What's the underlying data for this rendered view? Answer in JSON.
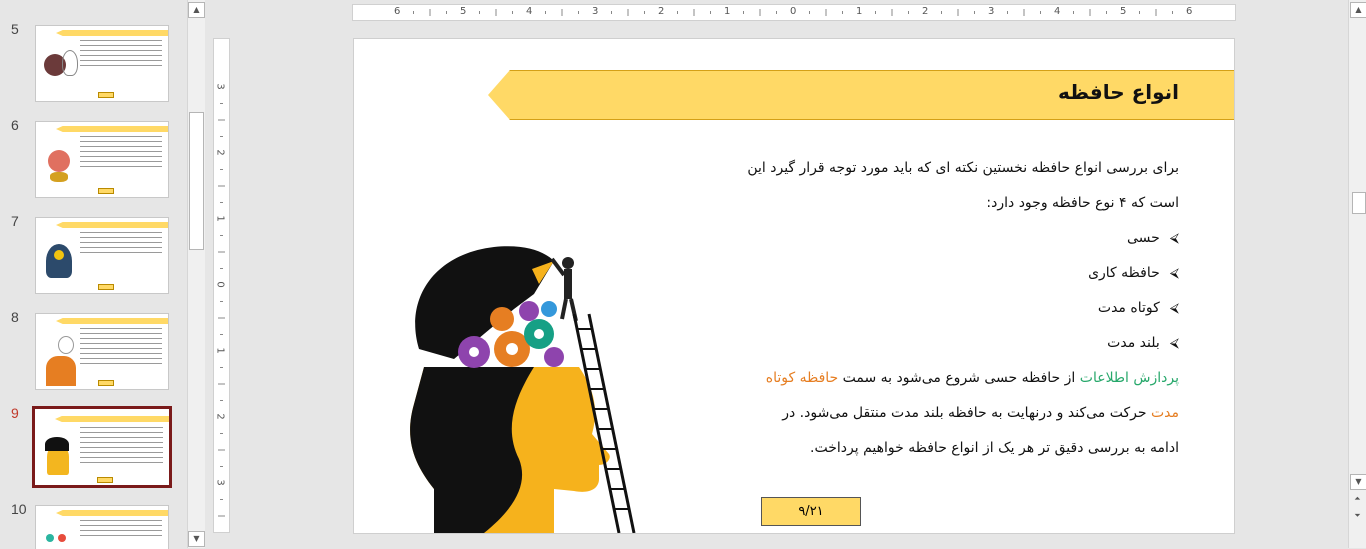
{
  "thumbnails": [
    {
      "num": "5"
    },
    {
      "num": "6"
    },
    {
      "num": "7"
    },
    {
      "num": "8"
    },
    {
      "num": "9",
      "active": true
    },
    {
      "num": "10"
    }
  ],
  "ruler": {
    "h_labels": [
      "6",
      "5",
      "4",
      "3",
      "2",
      "1",
      "0",
      "1",
      "2",
      "3",
      "4",
      "5",
      "6"
    ],
    "v_labels": [
      "3",
      "2",
      "1",
      "0",
      "1",
      "2",
      "3"
    ]
  },
  "slide": {
    "title": "انواع حافظه",
    "intro_line1": "برای بررسی انواع حافظه نخستین نکته ای که باید مورد توجه قرار گیرد این",
    "intro_line2": "است که ۴ نوع حافظه وجود دارد:",
    "bullets": [
      "حسی",
      "حافظه کاری",
      "کوتاه مدت",
      "بلند مدت"
    ],
    "bullet_marker": "⮘",
    "p2_green": "پردازش اطلاعات",
    "p2_mid": " از حافظه حسی شروع می‌شود به سمت ",
    "p2_orange": "حافظه کوتاه",
    "p3_orange": "مدت",
    "p3_rest": " حرکت می‌کند و درنهایت به حافظه بلند مدت منتقل می‌شود. در",
    "p4": "ادامه به بررسی دقیق تر هر یک از انواع حافظه خواهیم پرداخت.",
    "slide_number": "۹/۲۱"
  },
  "colors": {
    "banner": "#ffd966",
    "green": "#27a86b",
    "orange": "#e67e22",
    "active_border": "#7a1a1a"
  }
}
